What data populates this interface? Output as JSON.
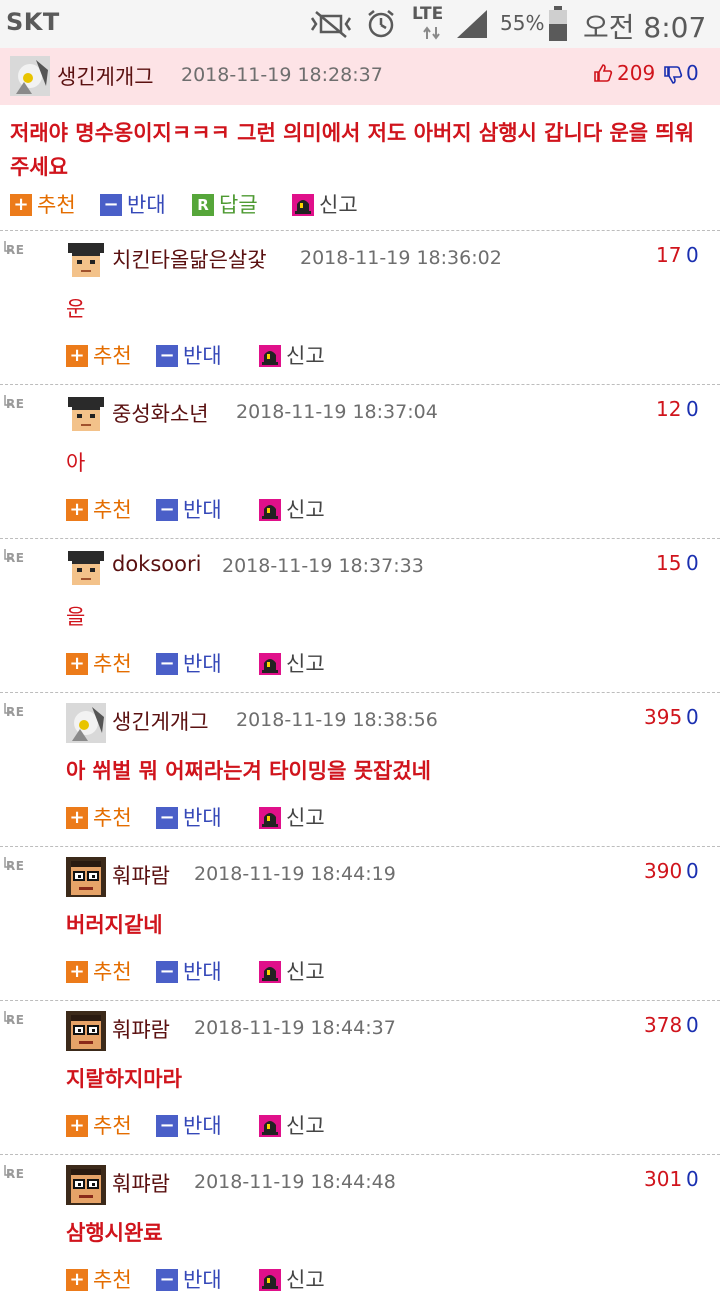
{
  "status_bar": {
    "carrier": "SKT",
    "network": "LTE",
    "battery": "55%",
    "clock": "오전 8:07",
    "icons": [
      "mute-vibrate-icon",
      "alarm-icon",
      "lte-icon",
      "signal-icon",
      "battery-icon"
    ]
  },
  "top_comment": {
    "author": "생긴게개그",
    "datetime": "2018-11-19 18:28:37",
    "upvotes": "209",
    "downvotes": "0",
    "body": "저래야 명수옹이지ㅋㅋㅋ 그런 의미에서 저도 아버지 삼행시 갑니다 운을 띄워주세요",
    "actions": {
      "recommend": "추천",
      "oppose": "반대",
      "reply": "답글",
      "report": "신고"
    }
  },
  "actions": {
    "recommend": "추천",
    "oppose": "반대",
    "report": "신고"
  },
  "replies": [
    {
      "re": "RE",
      "author": "치킨타올닮은살갗",
      "datetime": "2018-11-19 18:36:02",
      "up": "17",
      "down": "0",
      "body": "운",
      "bold": false,
      "avatar": "pixel"
    },
    {
      "re": "RE",
      "author": "중성화소년",
      "datetime": "2018-11-19 18:37:04",
      "up": "12",
      "down": "0",
      "body": "아",
      "bold": false,
      "avatar": "pixel"
    },
    {
      "re": "RE",
      "author": "doksoori",
      "datetime": "2018-11-19 18:37:33",
      "up": "15",
      "down": "0",
      "body": "을",
      "bold": false,
      "avatar": "pixel"
    },
    {
      "re": "RE",
      "author": "생긴게개그",
      "datetime": "2018-11-19 18:38:56",
      "up": "395",
      "down": "0",
      "body": "아 쒸벌 뭐 어쩌라는겨 타이밍을 못잡겄네",
      "bold": true,
      "avatar": "photo"
    },
    {
      "re": "RE",
      "author": "훠퍄람",
      "datetime": "2018-11-19 18:44:19",
      "up": "390",
      "down": "0",
      "body": "버러지같네",
      "bold": true,
      "avatar": "glasses"
    },
    {
      "re": "RE",
      "author": "훠퍄람",
      "datetime": "2018-11-19 18:44:37",
      "up": "378",
      "down": "0",
      "body": "지랄하지마라",
      "bold": true,
      "avatar": "glasses"
    },
    {
      "re": "RE",
      "author": "훠퍄람",
      "datetime": "2018-11-19 18:44:48",
      "up": "301",
      "down": "0",
      "body": "삼행시완료",
      "bold": true,
      "avatar": "glasses"
    }
  ]
}
